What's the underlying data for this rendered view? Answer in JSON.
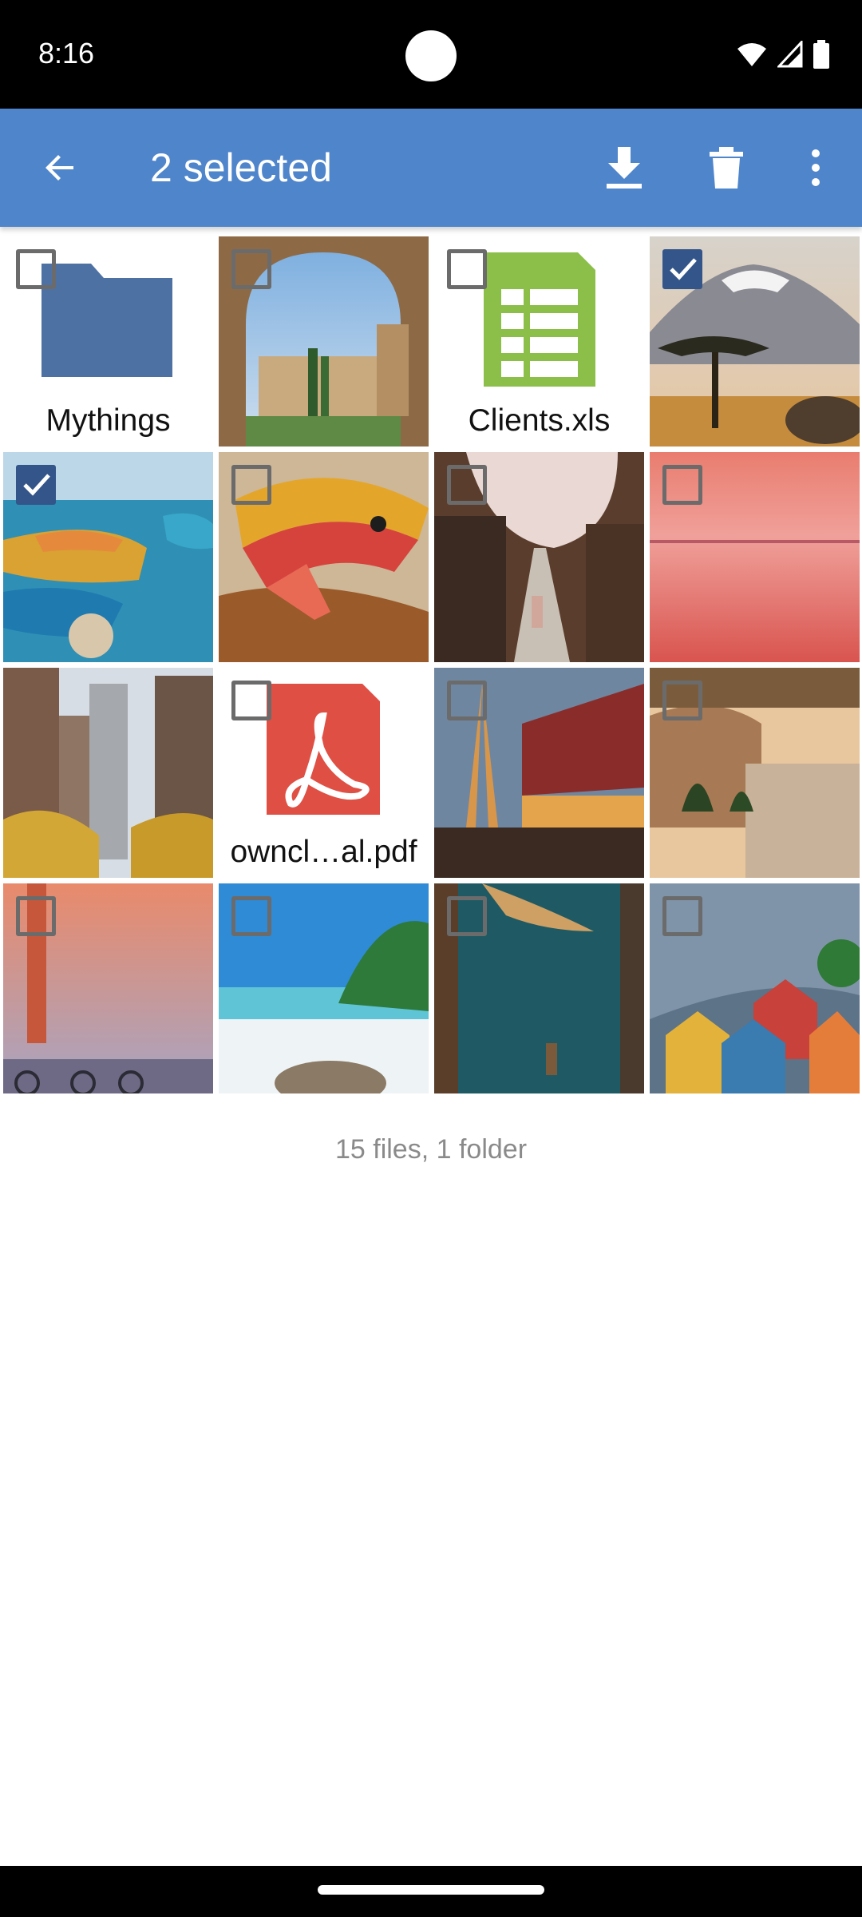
{
  "status_bar": {
    "time": "8:16"
  },
  "app_bar": {
    "title": "2 selected",
    "accent_color": "#4F85CB",
    "actions": [
      "download-icon",
      "delete-icon",
      "more-vert-icon"
    ]
  },
  "items": [
    {
      "label": "Mythings",
      "kind": "folder",
      "checked": false
    },
    {
      "label": "",
      "kind": "image",
      "checked": false
    },
    {
      "label": "Clients.xls",
      "kind": "spreadsheet",
      "checked": false
    },
    {
      "label": "",
      "kind": "image",
      "checked": true
    },
    {
      "label": "",
      "kind": "image",
      "checked": true
    },
    {
      "label": "",
      "kind": "image",
      "checked": false
    },
    {
      "label": "",
      "kind": "image",
      "checked": false
    },
    {
      "label": "",
      "kind": "image",
      "checked": false
    },
    {
      "label": "",
      "kind": "image",
      "checked": false
    },
    {
      "label": "owncl…al.pdf",
      "kind": "pdf",
      "checked": false
    },
    {
      "label": "",
      "kind": "image",
      "checked": false
    },
    {
      "label": "",
      "kind": "image",
      "checked": false
    },
    {
      "label": "",
      "kind": "image",
      "checked": false
    },
    {
      "label": "",
      "kind": "image",
      "checked": false
    },
    {
      "label": "",
      "kind": "image",
      "checked": false
    },
    {
      "label": "",
      "kind": "image",
      "checked": false
    }
  ],
  "summary": "15 files, 1 folder"
}
